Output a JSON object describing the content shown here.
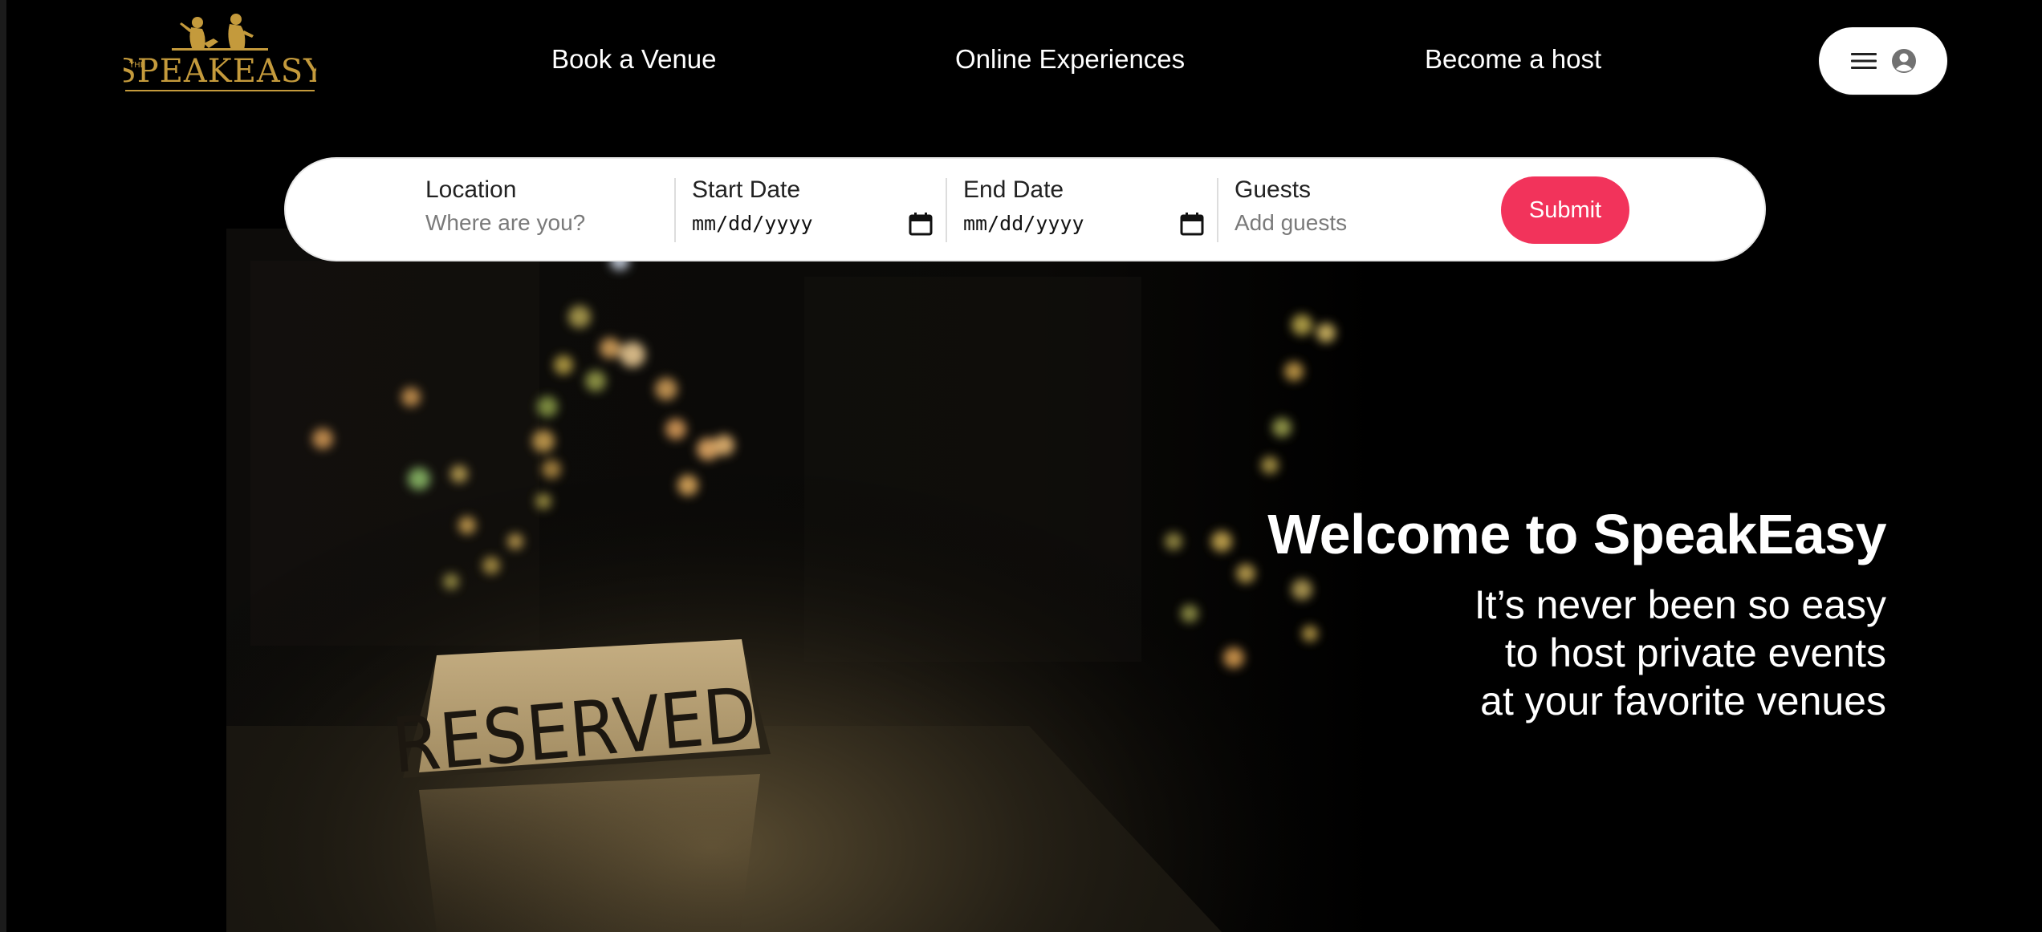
{
  "brand": {
    "logo_text": "SPEAKEASY",
    "logo_prefix": "THE",
    "logo_color": "#c49a3c"
  },
  "nav": {
    "links": [
      "Book a Venue",
      "Online Experiences",
      "Become a host"
    ]
  },
  "user_menu": {
    "icons": [
      "hamburger-menu-icon",
      "user-avatar-icon"
    ]
  },
  "search": {
    "location": {
      "label": "Location",
      "placeholder": "Where are you?"
    },
    "start_date": {
      "label": "Start Date",
      "value": "mm/dd/yyyy"
    },
    "end_date": {
      "label": "End Date",
      "value": "mm/dd/yyyy"
    },
    "guests": {
      "label": "Guests",
      "placeholder": "Add guests"
    },
    "submit_label": "Submit"
  },
  "hero": {
    "title": "Welcome to SpeakEasy",
    "subtitle_lines": [
      "It’s never been so easy",
      "to host private events",
      "at your favorite venues"
    ],
    "sign_text": "RESERVED"
  },
  "colors": {
    "accent": "#f2335b",
    "background": "#000000",
    "gold": "#c49a3c"
  }
}
